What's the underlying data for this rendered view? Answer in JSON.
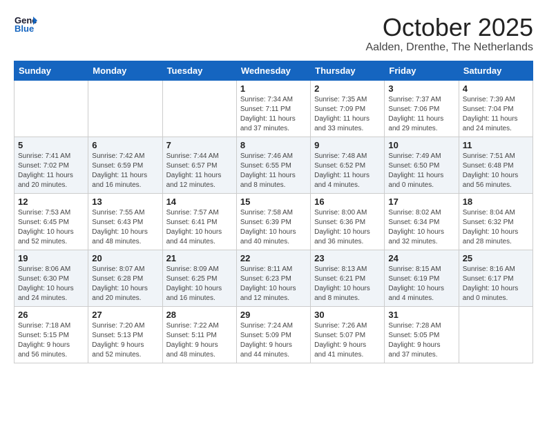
{
  "header": {
    "logo_general": "General",
    "logo_blue": "Blue",
    "month": "October 2025",
    "location": "Aalden, Drenthe, The Netherlands"
  },
  "weekdays": [
    "Sunday",
    "Monday",
    "Tuesday",
    "Wednesday",
    "Thursday",
    "Friday",
    "Saturday"
  ],
  "weeks": [
    [
      {
        "day": "",
        "info": ""
      },
      {
        "day": "",
        "info": ""
      },
      {
        "day": "",
        "info": ""
      },
      {
        "day": "1",
        "info": "Sunrise: 7:34 AM\nSunset: 7:11 PM\nDaylight: 11 hours\nand 37 minutes."
      },
      {
        "day": "2",
        "info": "Sunrise: 7:35 AM\nSunset: 7:09 PM\nDaylight: 11 hours\nand 33 minutes."
      },
      {
        "day": "3",
        "info": "Sunrise: 7:37 AM\nSunset: 7:06 PM\nDaylight: 11 hours\nand 29 minutes."
      },
      {
        "day": "4",
        "info": "Sunrise: 7:39 AM\nSunset: 7:04 PM\nDaylight: 11 hours\nand 24 minutes."
      }
    ],
    [
      {
        "day": "5",
        "info": "Sunrise: 7:41 AM\nSunset: 7:02 PM\nDaylight: 11 hours\nand 20 minutes."
      },
      {
        "day": "6",
        "info": "Sunrise: 7:42 AM\nSunset: 6:59 PM\nDaylight: 11 hours\nand 16 minutes."
      },
      {
        "day": "7",
        "info": "Sunrise: 7:44 AM\nSunset: 6:57 PM\nDaylight: 11 hours\nand 12 minutes."
      },
      {
        "day": "8",
        "info": "Sunrise: 7:46 AM\nSunset: 6:55 PM\nDaylight: 11 hours\nand 8 minutes."
      },
      {
        "day": "9",
        "info": "Sunrise: 7:48 AM\nSunset: 6:52 PM\nDaylight: 11 hours\nand 4 minutes."
      },
      {
        "day": "10",
        "info": "Sunrise: 7:49 AM\nSunset: 6:50 PM\nDaylight: 11 hours\nand 0 minutes."
      },
      {
        "day": "11",
        "info": "Sunrise: 7:51 AM\nSunset: 6:48 PM\nDaylight: 10 hours\nand 56 minutes."
      }
    ],
    [
      {
        "day": "12",
        "info": "Sunrise: 7:53 AM\nSunset: 6:45 PM\nDaylight: 10 hours\nand 52 minutes."
      },
      {
        "day": "13",
        "info": "Sunrise: 7:55 AM\nSunset: 6:43 PM\nDaylight: 10 hours\nand 48 minutes."
      },
      {
        "day": "14",
        "info": "Sunrise: 7:57 AM\nSunset: 6:41 PM\nDaylight: 10 hours\nand 44 minutes."
      },
      {
        "day": "15",
        "info": "Sunrise: 7:58 AM\nSunset: 6:39 PM\nDaylight: 10 hours\nand 40 minutes."
      },
      {
        "day": "16",
        "info": "Sunrise: 8:00 AM\nSunset: 6:36 PM\nDaylight: 10 hours\nand 36 minutes."
      },
      {
        "day": "17",
        "info": "Sunrise: 8:02 AM\nSunset: 6:34 PM\nDaylight: 10 hours\nand 32 minutes."
      },
      {
        "day": "18",
        "info": "Sunrise: 8:04 AM\nSunset: 6:32 PM\nDaylight: 10 hours\nand 28 minutes."
      }
    ],
    [
      {
        "day": "19",
        "info": "Sunrise: 8:06 AM\nSunset: 6:30 PM\nDaylight: 10 hours\nand 24 minutes."
      },
      {
        "day": "20",
        "info": "Sunrise: 8:07 AM\nSunset: 6:28 PM\nDaylight: 10 hours\nand 20 minutes."
      },
      {
        "day": "21",
        "info": "Sunrise: 8:09 AM\nSunset: 6:25 PM\nDaylight: 10 hours\nand 16 minutes."
      },
      {
        "day": "22",
        "info": "Sunrise: 8:11 AM\nSunset: 6:23 PM\nDaylight: 10 hours\nand 12 minutes."
      },
      {
        "day": "23",
        "info": "Sunrise: 8:13 AM\nSunset: 6:21 PM\nDaylight: 10 hours\nand 8 minutes."
      },
      {
        "day": "24",
        "info": "Sunrise: 8:15 AM\nSunset: 6:19 PM\nDaylight: 10 hours\nand 4 minutes."
      },
      {
        "day": "25",
        "info": "Sunrise: 8:16 AM\nSunset: 6:17 PM\nDaylight: 10 hours\nand 0 minutes."
      }
    ],
    [
      {
        "day": "26",
        "info": "Sunrise: 7:18 AM\nSunset: 5:15 PM\nDaylight: 9 hours\nand 56 minutes."
      },
      {
        "day": "27",
        "info": "Sunrise: 7:20 AM\nSunset: 5:13 PM\nDaylight: 9 hours\nand 52 minutes."
      },
      {
        "day": "28",
        "info": "Sunrise: 7:22 AM\nSunset: 5:11 PM\nDaylight: 9 hours\nand 48 minutes."
      },
      {
        "day": "29",
        "info": "Sunrise: 7:24 AM\nSunset: 5:09 PM\nDaylight: 9 hours\nand 44 minutes."
      },
      {
        "day": "30",
        "info": "Sunrise: 7:26 AM\nSunset: 5:07 PM\nDaylight: 9 hours\nand 41 minutes."
      },
      {
        "day": "31",
        "info": "Sunrise: 7:28 AM\nSunset: 5:05 PM\nDaylight: 9 hours\nand 37 minutes."
      },
      {
        "day": "",
        "info": ""
      }
    ]
  ]
}
